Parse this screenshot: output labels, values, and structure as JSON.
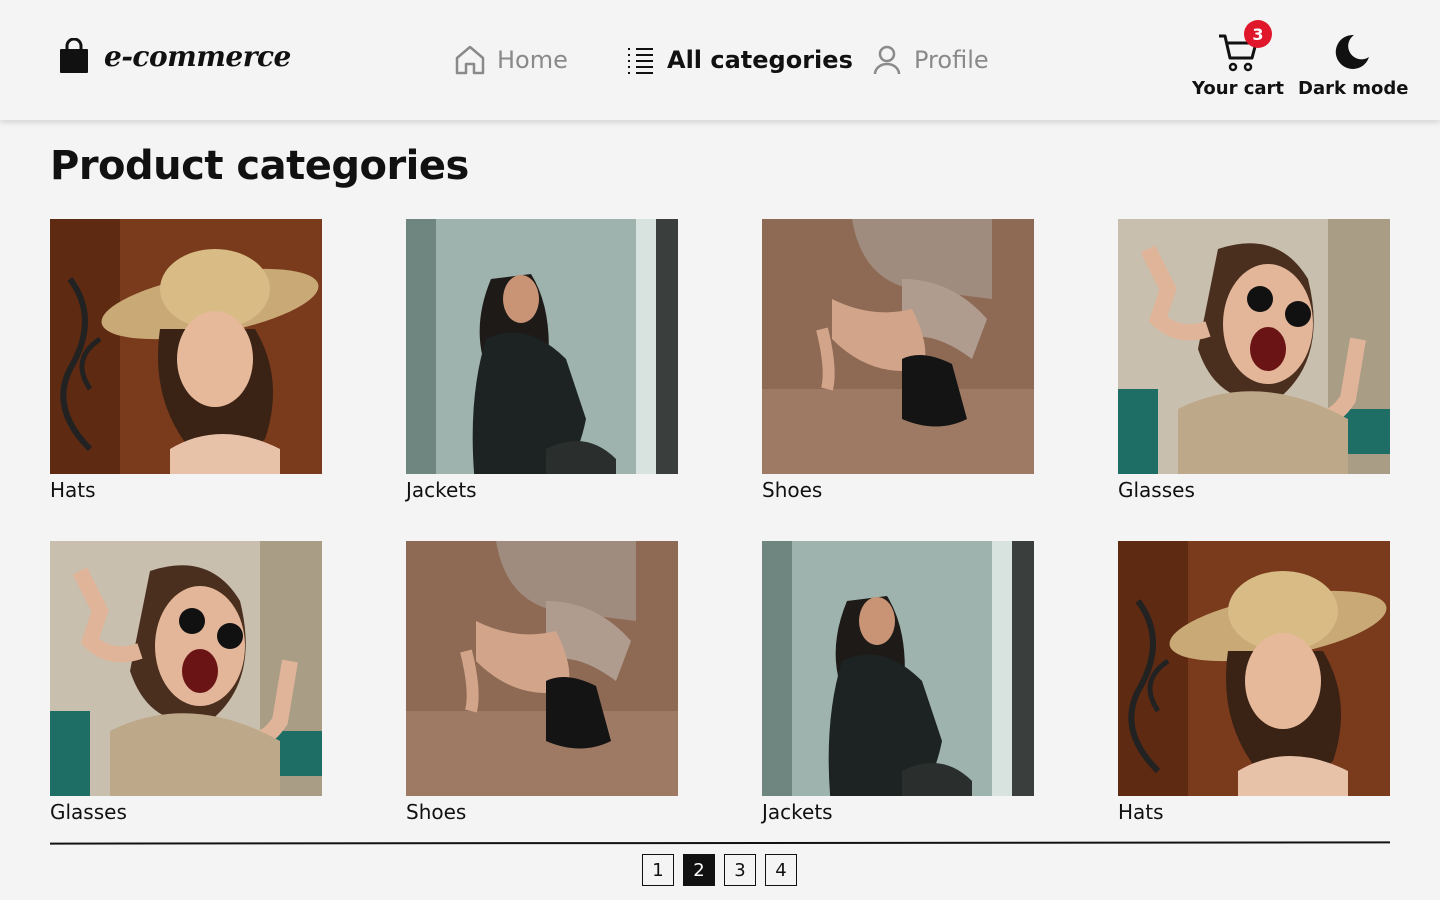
{
  "brand": {
    "name": "e-commerce"
  },
  "nav": {
    "home": "Home",
    "categories": "All categories",
    "profile": "Profile"
  },
  "cart": {
    "label": "Your cart",
    "count": "3"
  },
  "theme": {
    "label": "Dark mode"
  },
  "page": {
    "title": "Product categories"
  },
  "categories": [
    {
      "label": "Hats",
      "image": "hat"
    },
    {
      "label": "Jackets",
      "image": "jacket"
    },
    {
      "label": "Shoes",
      "image": "shoes"
    },
    {
      "label": "Glasses",
      "image": "glasses"
    },
    {
      "label": "Glasses",
      "image": "glasses"
    },
    {
      "label": "Shoes",
      "image": "shoes"
    },
    {
      "label": "Jackets",
      "image": "jacket"
    },
    {
      "label": "Hats",
      "image": "hat"
    }
  ],
  "pagination": {
    "pages": [
      "1",
      "2",
      "3",
      "4"
    ],
    "current": "2"
  },
  "colors": {
    "badge": "#e0162b",
    "background": "#f4f4f4",
    "text": "#111111",
    "muted": "#8a8a8a"
  }
}
